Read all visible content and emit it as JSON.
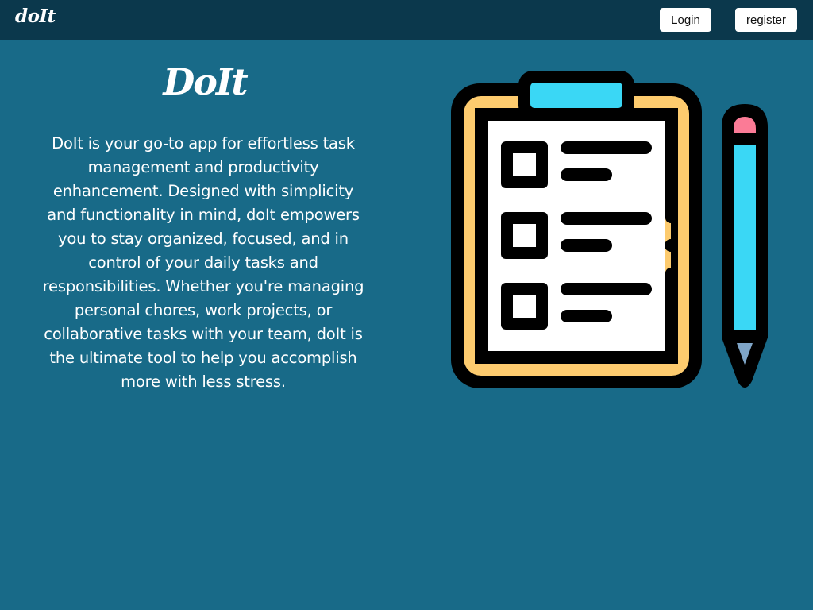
{
  "navbar": {
    "logo": "doIt",
    "login_label": "Login",
    "register_label": "register"
  },
  "hero": {
    "title": "DoIt",
    "description": "DoIt is your go-to app for effortless task management and productivity enhancement. Designed with simplicity and functionality in mind, doIt empowers you to stay organized, focused, and in control of your daily tasks and responsibilities. Whether you're managing personal chores, work projects, or collaborative tasks with your team, doIt is the ultimate tool to help you accomplish more with less stress."
  },
  "illustration": {
    "icons": [
      "clipboard-checklist-icon",
      "pencil-icon"
    ]
  },
  "colors": {
    "background": "#186a88",
    "navbar": "#0b384c",
    "clipboard_board": "#fdcb6e",
    "clip": "#3ad7f5",
    "pencil_eraser": "#fb7b96",
    "pencil_tip": "#7fa5c7"
  }
}
